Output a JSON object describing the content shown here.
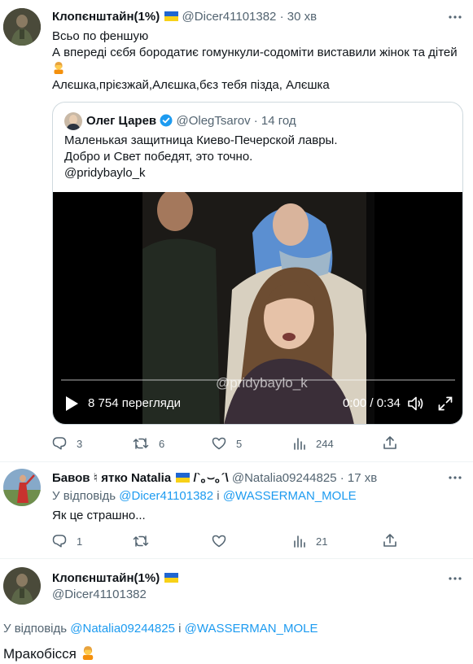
{
  "colors": {
    "accent": "#1d9bf0",
    "muted": "#536471",
    "text": "#0f1419",
    "verified": "#1d9bf0"
  },
  "tweet1": {
    "name": "Клопєнштайн(1%)",
    "handle": "@Dicer41101382",
    "sep": "·",
    "time": "30 хв",
    "line1": "Всьо по феншую",
    "line2": "А впереді сєбя бородатиє гомункули-содоміти виставили жінок та дітей",
    "line4": "Алєшка,прієзжай,Алєшка,бєз тебя пізда, Алєшка",
    "quote": {
      "name": "Олег Царев",
      "handle": "@OlegTsarov",
      "sep": "·",
      "time": "14 год",
      "line1": "Маленькая защитница Киево-Печерской лавры.",
      "line2": "Добро и Свет победят, это точно.",
      "line3": "@pridybaylo_k",
      "video": {
        "views": "8 754 перегляди",
        "time": "0:00 / 0:34",
        "watermark": "@pridybaylo_k",
        "progress": 0
      }
    },
    "actions": {
      "replies": "3",
      "retweets": "6",
      "likes": "5",
      "views": "244"
    }
  },
  "tweet2": {
    "name": "Бавов ♮ ятко Natalia",
    "name_suffix": "/`｡⌣｡´\\",
    "handle": "@Natalia09244825",
    "sep": "·",
    "time": "17 хв",
    "reply_prefix": "У відповідь",
    "reply_user1": "@Dicer41101382",
    "reply_and": "і",
    "reply_user2": "@WASSERMAN_MOLE",
    "text": "Як це страшно...",
    "actions": {
      "replies": "1",
      "retweets": "",
      "likes": "",
      "views": "21"
    }
  },
  "tweet3": {
    "name": "Клопєнштайн(1%)",
    "handle": "@Dicer41101382",
    "reply_prefix": "У відповідь",
    "reply_user1": "@Natalia09244825",
    "reply_and": "і",
    "reply_user2": "@WASSERMAN_MOLE",
    "text": "Мракобісся"
  }
}
